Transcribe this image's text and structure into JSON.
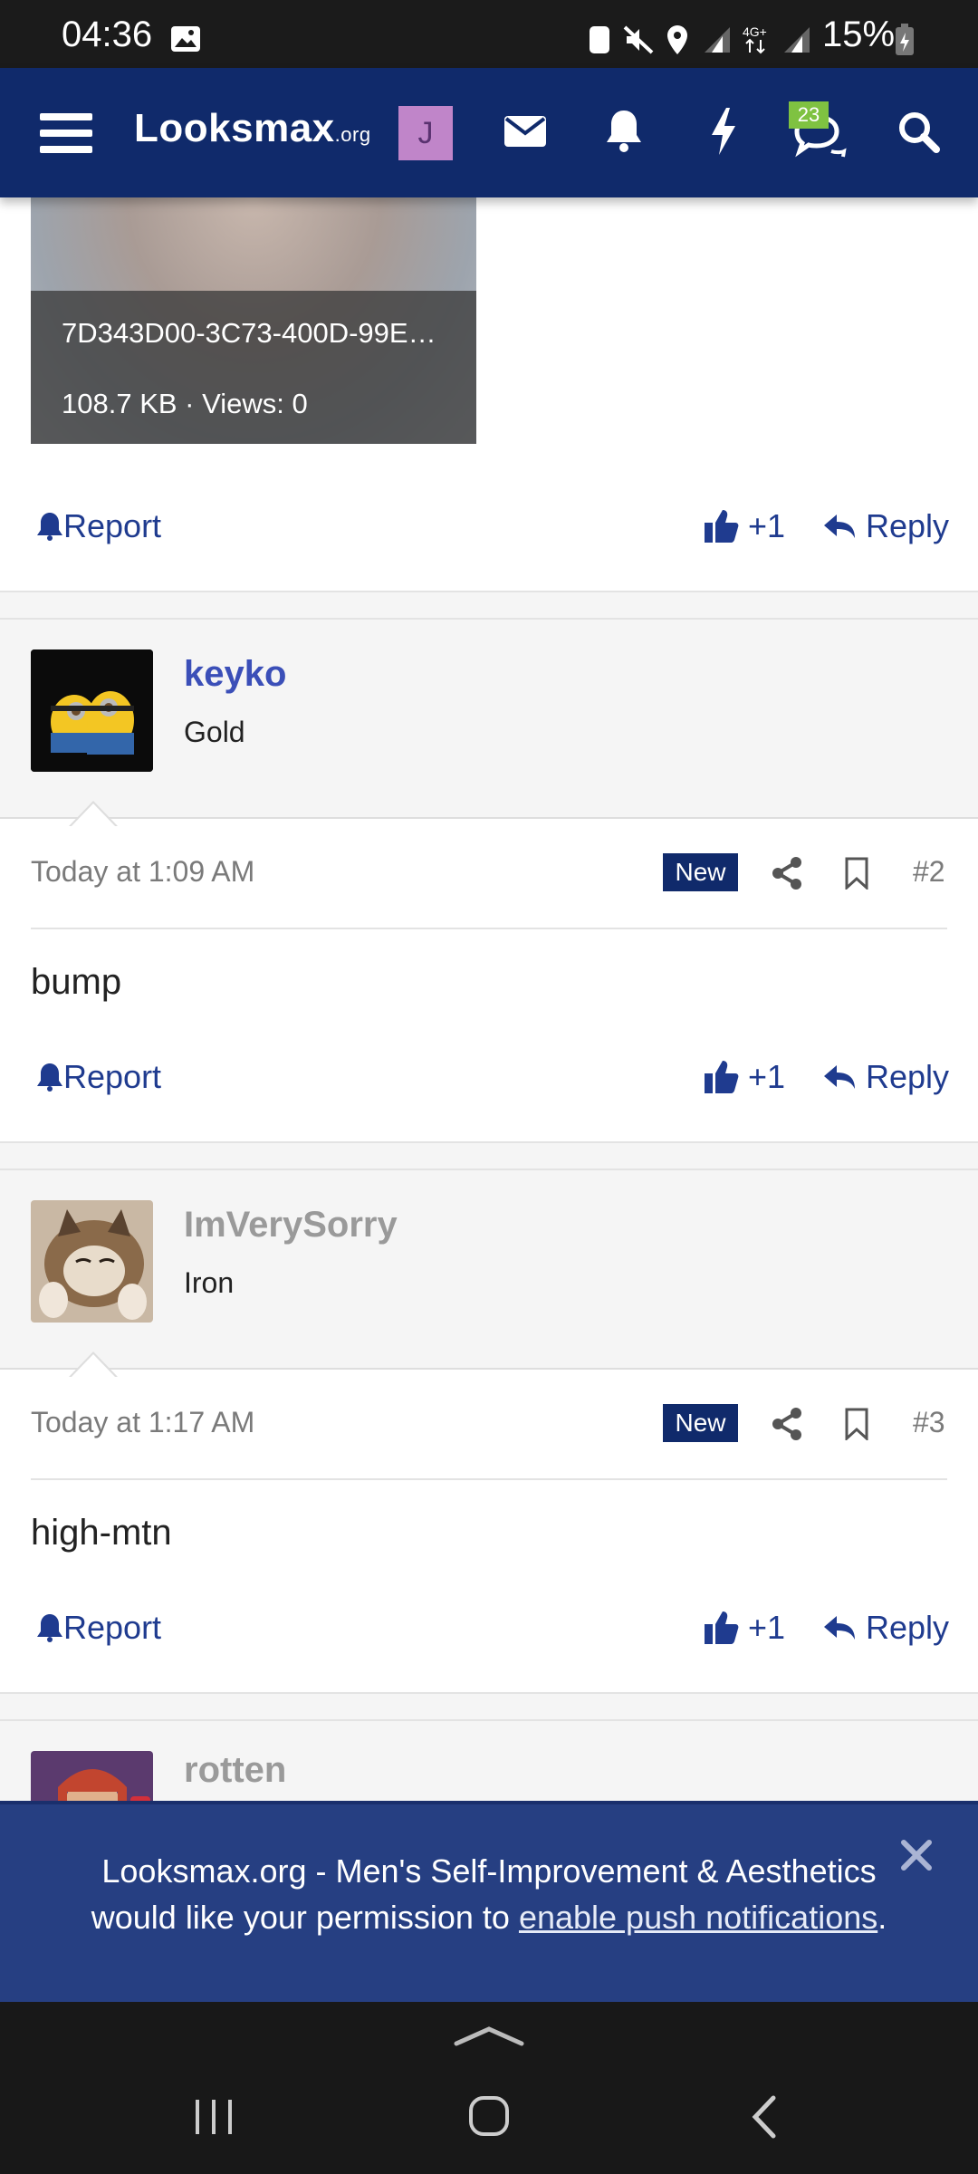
{
  "status_bar": {
    "time": "04:36",
    "battery": "15%"
  },
  "nav": {
    "logo": "Looksmax",
    "logo_suffix": ".org",
    "avatar_letter": "J",
    "conversations_badge": "23"
  },
  "attachment": {
    "filename": "7D343D00-3C73-400D-99E…",
    "meta": "108.7 KB · Views: 0"
  },
  "actions": {
    "report": "Report",
    "like": "+1",
    "reply": "Reply"
  },
  "posts": [
    {
      "user": "keyko",
      "rank": "Gold",
      "user_color": "#3b4fb8",
      "date": "Today at 1:09 AM",
      "badge": "New",
      "number": "#2",
      "body": "bump"
    },
    {
      "user": "ImVerySorry",
      "rank": "Iron",
      "user_color": "#9a9a9a",
      "date": "Today at 1:17 AM",
      "badge": "New",
      "number": "#3",
      "body": "high-mtn"
    },
    {
      "user": "rotten",
      "user_color": "#9a9a9a"
    }
  ],
  "push_prompt": {
    "line1": "Looksmax.org - Men's Self-Improvement & Aesthetics",
    "line2_prefix": "would like your permission to ",
    "link": "enable push notifications",
    "line2_suffix": "."
  }
}
